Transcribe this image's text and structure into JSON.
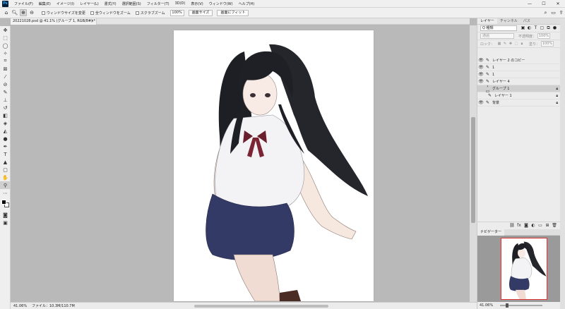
{
  "app": {
    "logo": "Ps"
  },
  "menu": [
    "ファイル(F)",
    "編集(E)",
    "イメージ(I)",
    "レイヤー(L)",
    "書式(Y)",
    "選択範囲(S)",
    "フィルター(T)",
    "3D(D)",
    "表示(V)",
    "ウィンドウ(W)",
    "ヘルプ(H)"
  ],
  "window_controls": {
    "minimize": "—",
    "maximize": "☐",
    "close": "✕"
  },
  "options": {
    "resize_windows": "ウィンドウサイズを変更",
    "all_windows": "全ウィンドウをズーム",
    "scrubby_zoom": "スクラブズーム",
    "zoom_value": "100%",
    "actual_pixels": "画面サイズ",
    "fit_screen": "画面にフィット"
  },
  "document": {
    "tab_title": "20221028.psd @ 41.1% (グループ 1, RGB/8#) *",
    "close": "×"
  },
  "status": {
    "zoom": "41.06%",
    "file_info": "ファイル：10.3M/110.7M"
  },
  "layers_panel": {
    "tabs": [
      "レイヤー",
      "チャンネル",
      "パス"
    ],
    "kind": "Q 種類",
    "blend": "通過",
    "opacity_label": "不透明度：",
    "opacity": "100%",
    "lock_label": "ロック：",
    "fill_label": "塗り：",
    "fill": "100%",
    "layers": [
      {
        "name": "レイヤー 2 のコピー",
        "visible": true,
        "type": "brush",
        "selected": false,
        "locked": false,
        "indent": false
      },
      {
        "name": "1",
        "visible": true,
        "type": "brush",
        "selected": false,
        "locked": false,
        "indent": false
      },
      {
        "name": "1",
        "visible": true,
        "type": "brush",
        "selected": false,
        "locked": false,
        "indent": false
      },
      {
        "name": "レイヤー 4",
        "visible": true,
        "type": "brush",
        "selected": false,
        "locked": false,
        "indent": false
      },
      {
        "name": "グループ 1",
        "visible": false,
        "type": "folder",
        "selected": true,
        "locked": true,
        "indent": false
      },
      {
        "name": "レイヤー 1",
        "visible": false,
        "type": "brush",
        "selected": false,
        "locked": true,
        "indent": true
      },
      {
        "name": "背景",
        "visible": true,
        "type": "brush",
        "selected": false,
        "locked": true,
        "indent": false
      }
    ]
  },
  "navigator": {
    "tab": "ナビゲーター",
    "zoom": "41.06%"
  }
}
